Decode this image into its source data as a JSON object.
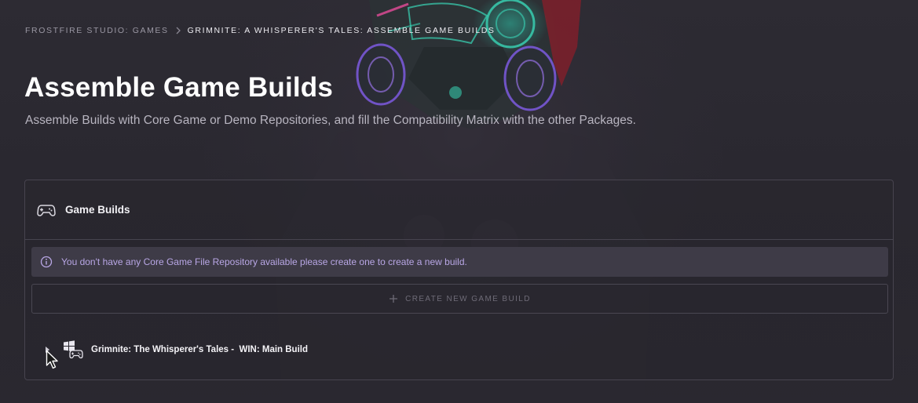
{
  "breadcrumb": {
    "parent": "FROSTFIRE STUDIO: GAMES",
    "current": "GRIMNITE: A WHISPERER'S TALES: ASSEMBLE GAME BUILDS"
  },
  "header": {
    "title": "Assemble Game Builds",
    "subtitle": "Assemble Builds with Core Game or Demo Repositories, and fill the Compatibility Matrix with the other Packages."
  },
  "panel": {
    "title": "Game Builds",
    "icon": "gamepad-icon",
    "info_message": "You don't have any Core Game File Repository available please create one to create a new build.",
    "create_button_label": "CREATE NEW GAME BUILD",
    "builds": [
      {
        "name": "Grimnite: The Whisperer's Tales -  WIN: Main Build",
        "platform_icon": "windows-gamepad-icon",
        "expanded": false
      }
    ]
  },
  "colors": {
    "background": "#2a2830",
    "info_banner_bg": "#3e3b47",
    "info_text": "#b9a7e6",
    "border": "#47444f"
  }
}
